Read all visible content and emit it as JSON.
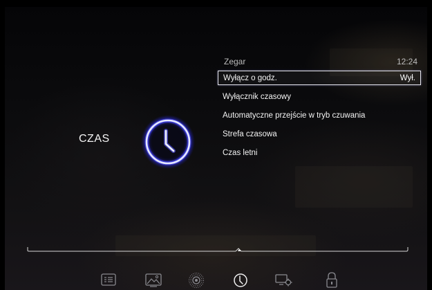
{
  "section": {
    "title": "CZAS",
    "icon": "clock-icon"
  },
  "menu": {
    "header_title": "Zegar",
    "header_time": "12:24",
    "items": [
      {
        "label": "Wyłącz o godz.",
        "value": "Wył.",
        "selected": true
      },
      {
        "label": "Wyłącznik czasowy",
        "value": "",
        "selected": false
      },
      {
        "label": "Automatyczne przejście w tryb czuwania",
        "value": "",
        "selected": false
      },
      {
        "label": "Strefa czasowa",
        "value": "",
        "selected": false
      },
      {
        "label": "Czas letni",
        "value": "",
        "selected": false
      }
    ]
  },
  "bottom_nav": {
    "icons": [
      "channel-list-icon",
      "picture-icon",
      "sound-icon",
      "time-icon",
      "settings-icon",
      "lock-icon"
    ],
    "active": "time-icon"
  },
  "colors": {
    "clock_glow": "#3a3ae8",
    "clock_ring": "#dfe4ff",
    "text": "#f3f3f3",
    "muted_text": "#bdbdbd",
    "line": "#d8d8d8"
  }
}
